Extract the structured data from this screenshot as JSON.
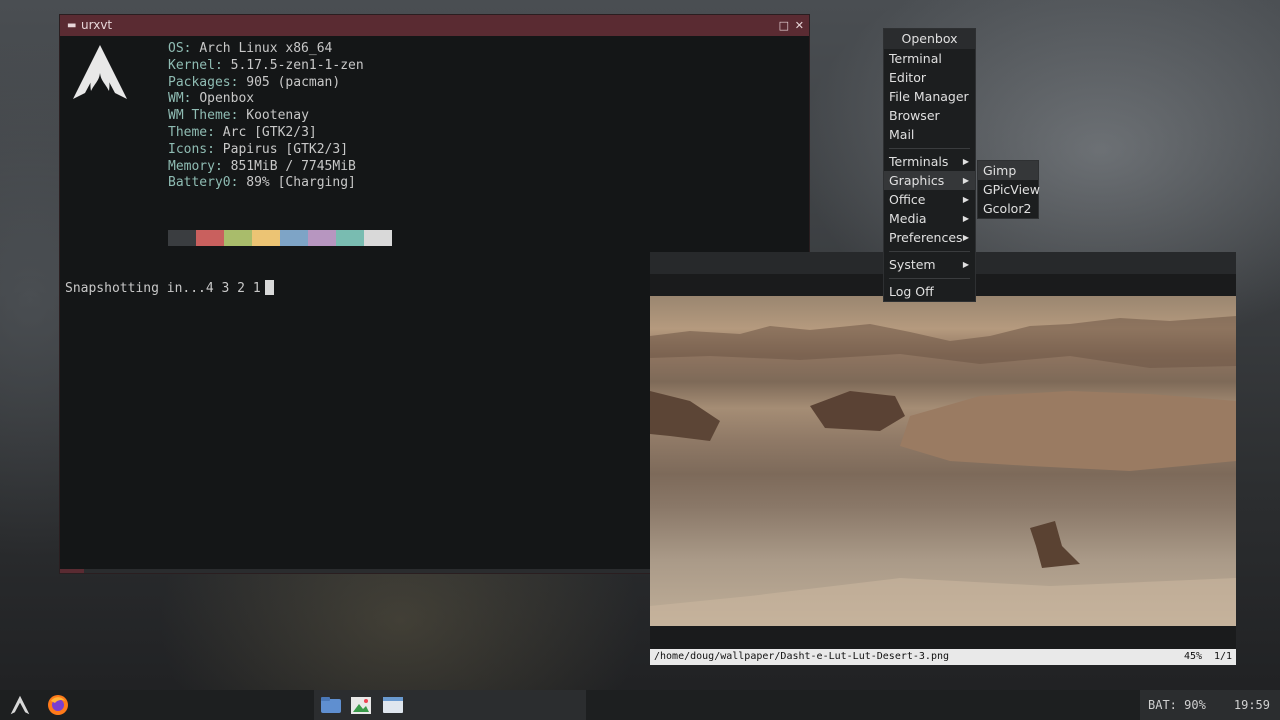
{
  "terminal": {
    "title": "urxvt",
    "info": [
      {
        "key": "OS",
        "value": "Arch Linux x86_64"
      },
      {
        "key": "Kernel",
        "value": "5.17.5-zen1-1-zen"
      },
      {
        "key": "Packages",
        "value": "905 (pacman)"
      },
      {
        "key": "WM",
        "value": "Openbox"
      },
      {
        "key": "WM Theme",
        "value": "Kootenay"
      },
      {
        "key": "Theme",
        "value": "Arc [GTK2/3]"
      },
      {
        "key": "Icons",
        "value": "Papirus [GTK2/3]"
      },
      {
        "key": "Memory",
        "value": "851MiB / 7745MiB"
      },
      {
        "key": "Battery0",
        "value": "89% [Charging]"
      }
    ],
    "palette": [
      "#3a3d40",
      "#c9605e",
      "#a9bc6b",
      "#ecc474",
      "#7ea4c6",
      "#b796c0",
      "#79bcb1",
      "#d9d9d9"
    ],
    "prompt": "Snapshotting in...4 3 2 1",
    "title_bar_color": "#5a2b32"
  },
  "viewer": {
    "path": "/home/doug/wallpaper/Dasht-e-Lut-Lut-Desert-3.png",
    "zoom": "45%",
    "count": "1/1"
  },
  "menu": {
    "title": "Openbox",
    "items": [
      "Terminal",
      "Editor",
      "File Manager",
      "Browser",
      "Mail"
    ],
    "submenus": [
      "Terminals",
      "Graphics",
      "Office",
      "Media",
      "Preferences"
    ],
    "system": "System",
    "logoff": "Log Off",
    "graphics_submenu": [
      "Gimp",
      "GPicView",
      "Gcolor2"
    ]
  },
  "taskbar": {
    "battery": "BAT: 90%",
    "clock": "19:59"
  }
}
